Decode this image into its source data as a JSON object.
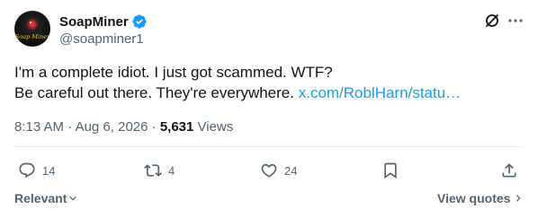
{
  "author": {
    "display_name": "SoapMiner",
    "handle": "@soapminer1",
    "avatar_text": "Soap Miner",
    "verified": true,
    "verified_color": "#1d9bf0"
  },
  "header": {
    "grok_icon": "grok-icon",
    "more_icon": "more-icon"
  },
  "post": {
    "line1": "I'm a complete idiot. I just got scammed. WTF?",
    "line2_text": "Be careful out there. They're everywhere. ",
    "line2_link": "x.com/RoblHarn/statu…",
    "link_color": "#1d9bf0"
  },
  "meta": {
    "time": "8:13 AM",
    "sep1": " · ",
    "date": "Aug 6, 2026",
    "sep2": " · ",
    "views_count": "5,631",
    "views_label": " Views"
  },
  "actions": {
    "replies": "14",
    "reposts": "4",
    "likes": "24"
  },
  "footer": {
    "sort_label": "Relevant",
    "view_quotes_label": "View quotes"
  },
  "colors": {
    "text_primary": "#0f1419",
    "text_secondary": "#536471",
    "divider": "#eff3f4"
  }
}
